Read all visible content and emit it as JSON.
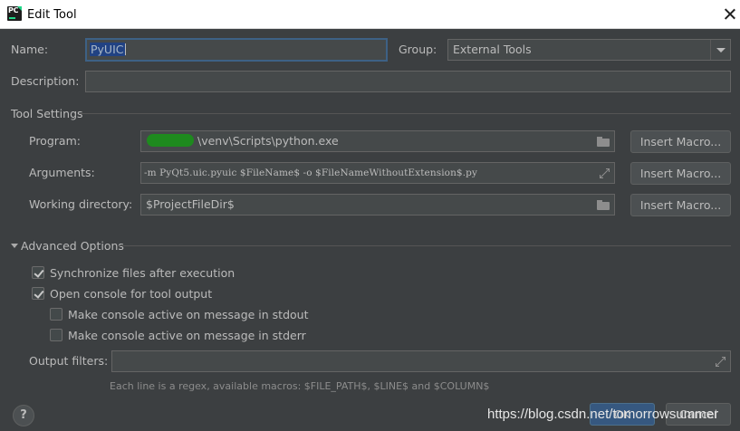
{
  "window": {
    "app_icon_text": "PC",
    "title": "Edit Tool"
  },
  "form": {
    "name_label": "Name:",
    "name_value": "PyUIC",
    "group_label": "Group:",
    "group_value": "External Tools",
    "description_label": "Description:",
    "description_value": ""
  },
  "tool_settings": {
    "section_label": "Tool Settings",
    "program_label": "Program:",
    "program_value": "\\venv\\Scripts\\python.exe",
    "arguments_label": "Arguments:",
    "arguments_value": "-m PyQt5.uic.pyuic $FileName$ -o $FileNameWithoutExtension$.py",
    "working_dir_label": "Working directory:",
    "working_dir_value": "$ProjectFileDir$",
    "insert_macro_label": "Insert Macro..."
  },
  "advanced": {
    "section_label": "Advanced Options",
    "options": [
      {
        "label": "Synchronize files after execution",
        "checked": true
      },
      {
        "label": "Open console for tool output",
        "checked": true
      },
      {
        "label": "Make console active on message in stdout",
        "checked": false
      },
      {
        "label": "Make console active on message in stderr",
        "checked": false
      }
    ],
    "output_filters_label": "Output filters:",
    "output_filters_value": "",
    "hint": "Each line is a regex, available macros: $FILE_PATH$, $LINE$ and $COLUMN$"
  },
  "footer": {
    "help_label": "?",
    "ok_label": "OK",
    "cancel_label": "Cancel",
    "watermark": "https://blog.csdn.net/tomorrowsummer"
  },
  "colors": {
    "background": "#3c3f41",
    "field": "#45494a",
    "accent_ok": "#365880",
    "selection": "#214283"
  }
}
